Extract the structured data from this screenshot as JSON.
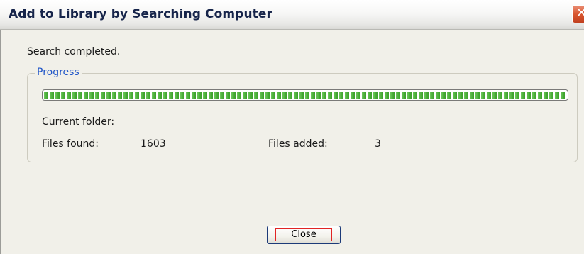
{
  "dialog": {
    "title": "Add to Library by Searching Computer",
    "status": "Search completed.",
    "close_icon": "close-x-icon"
  },
  "progress": {
    "legend": "Progress",
    "percent": 100,
    "current_folder_label": "Current folder:",
    "current_folder_value": "",
    "files_found_label": "Files found:",
    "files_found_value": "1603",
    "files_added_label": "Files added:",
    "files_added_value": "3"
  },
  "buttons": {
    "close_label": "Close"
  },
  "colors": {
    "accent_legend": "#1f55c8",
    "progress_fill": "#3ea22d",
    "close_focus_outline": "#e12424",
    "title_text": "#16244a"
  }
}
